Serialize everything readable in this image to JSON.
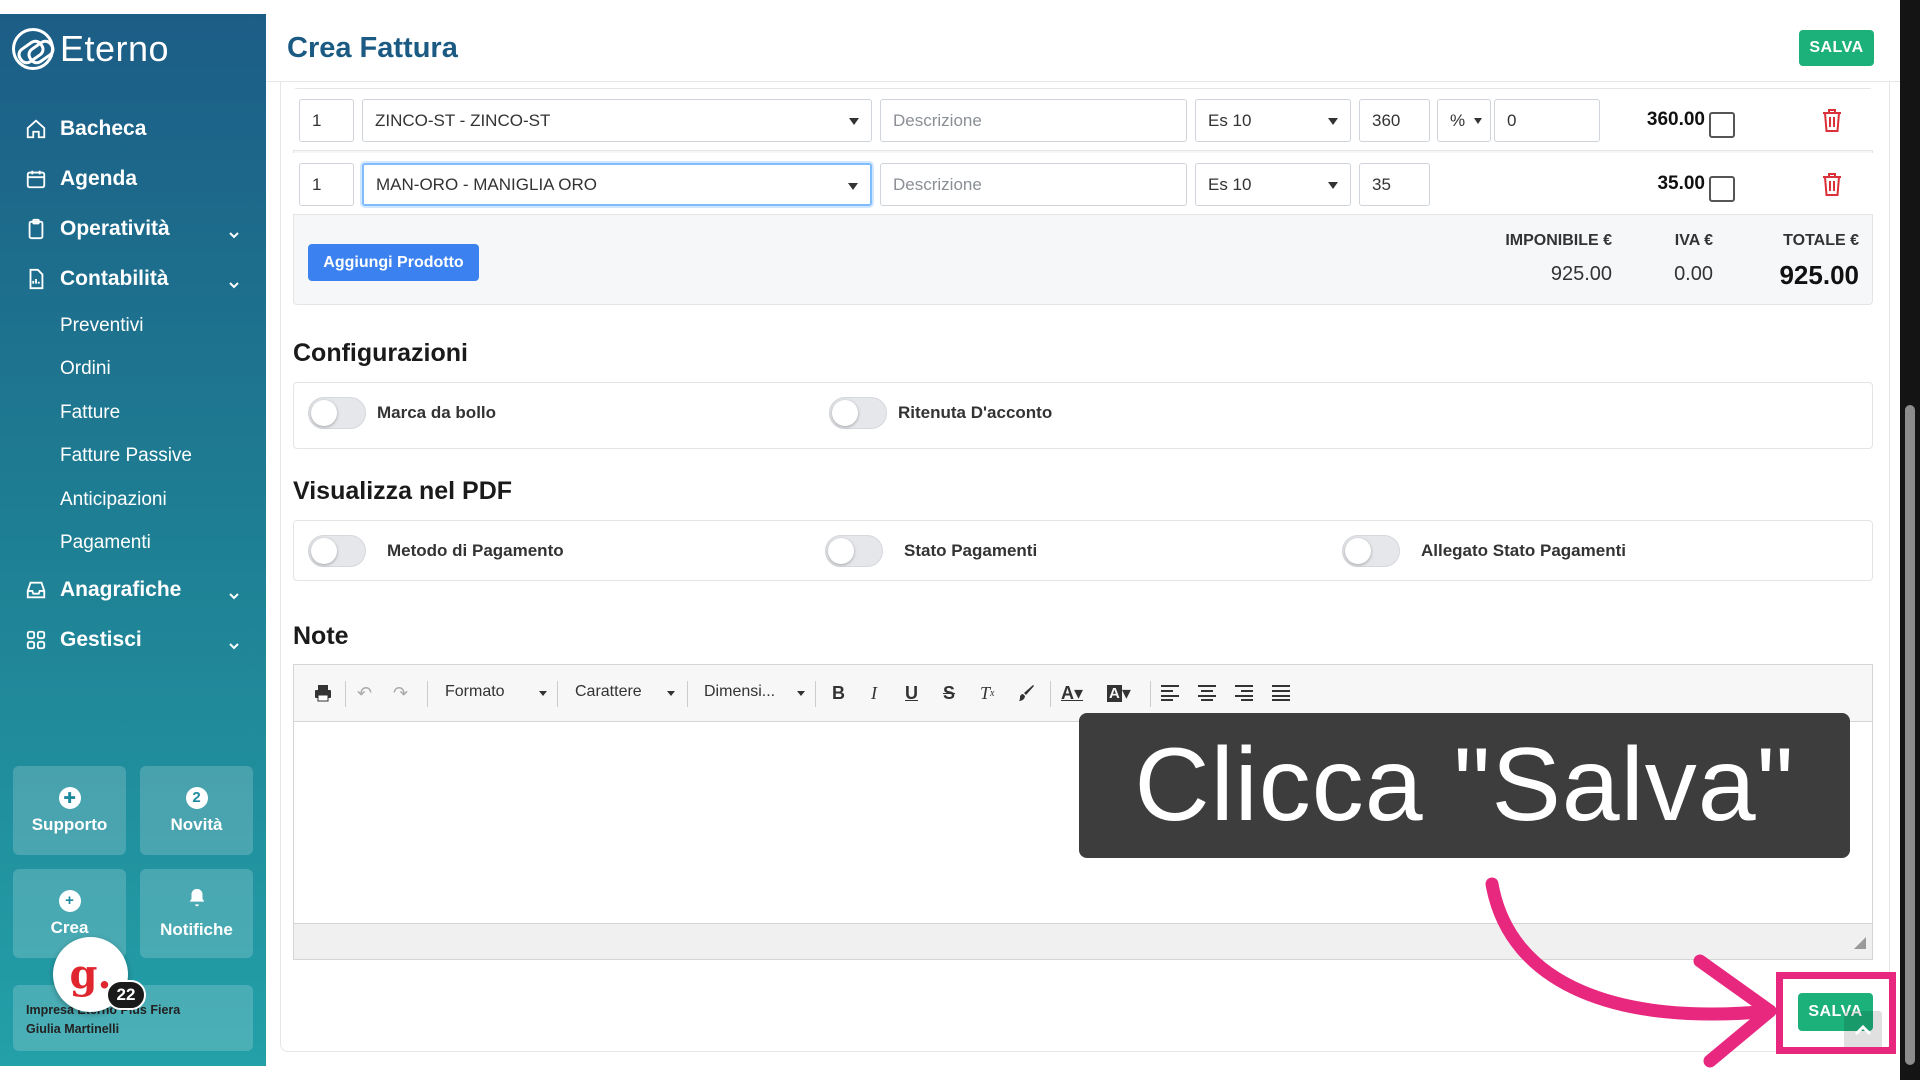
{
  "app": {
    "name": "Eterno"
  },
  "sidebar": {
    "items": [
      {
        "label": "Bacheca",
        "icon": "home-icon"
      },
      {
        "label": "Agenda",
        "icon": "calendar-icon"
      },
      {
        "label": "Operatività",
        "icon": "clipboard-icon",
        "expandable": true
      },
      {
        "label": "Contabilità",
        "icon": "document-icon",
        "expandable": true
      }
    ],
    "sub_items": [
      "Preventivi",
      "Ordini",
      "Fatture",
      "Fatture Passive",
      "Anticipazioni",
      "Pagamenti"
    ],
    "bottom_items": [
      {
        "label": "Anagrafiche",
        "icon": "inbox-icon",
        "expandable": true
      },
      {
        "label": "Gestisci",
        "icon": "grid-icon",
        "expandable": true
      }
    ],
    "buttons": {
      "supporto": "Supporto",
      "novita": "Novità",
      "novita_count": "2",
      "crea": "Crea",
      "notifiche": "Notifiche"
    },
    "user": {
      "company": "Impresa Eterno Plus Fiera",
      "name": "Giulia Martinelli"
    },
    "avatar_badge": "22",
    "avatar_letter": "g."
  },
  "header": {
    "title": "Crea Fattura",
    "save_label": "SALVA"
  },
  "products": {
    "rows": [
      {
        "qty": "1",
        "product": "ZINCO-ST - ZINCO-ST",
        "description_placeholder": "Descrizione",
        "vat": "Es 10",
        "price": "360",
        "discount_type": "%",
        "discount": "0",
        "total": "360.00"
      },
      {
        "qty": "1",
        "product": "MAN-ORO - MANIGLIA ORO",
        "description_placeholder": "Descrizione",
        "vat": "Es 10",
        "price": "35",
        "total": "35.00"
      }
    ],
    "add_label": "Aggiungi Prodotto",
    "totals": {
      "imponibile_label": "IMPONIBILE €",
      "imponibile": "925.00",
      "iva_label": "IVA €",
      "iva": "0.00",
      "totale_label": "TOTALE €",
      "totale": "925.00"
    }
  },
  "configurazioni": {
    "title": "Configurazioni",
    "toggles": [
      "Marca da bollo",
      "Ritenuta D'acconto"
    ]
  },
  "pdf": {
    "title": "Visualizza nel PDF",
    "toggles": [
      "Metodo di Pagamento",
      "Stato Pagamenti",
      "Allegato Stato Pagamenti"
    ]
  },
  "note": {
    "title": "Note",
    "toolbar": {
      "formato": "Formato",
      "carattere": "Carattere",
      "dimensione": "Dimensi..."
    }
  },
  "overlay": {
    "callout": "Clicca \"Salva\"",
    "accent_color": "#e8277f"
  },
  "bottom_save_label": "SALVA",
  "colors": {
    "save_green": "#1cb07a",
    "primary_blue": "#3b82f0",
    "title_blue": "#1b5a82",
    "delete_red": "#d9303a"
  }
}
